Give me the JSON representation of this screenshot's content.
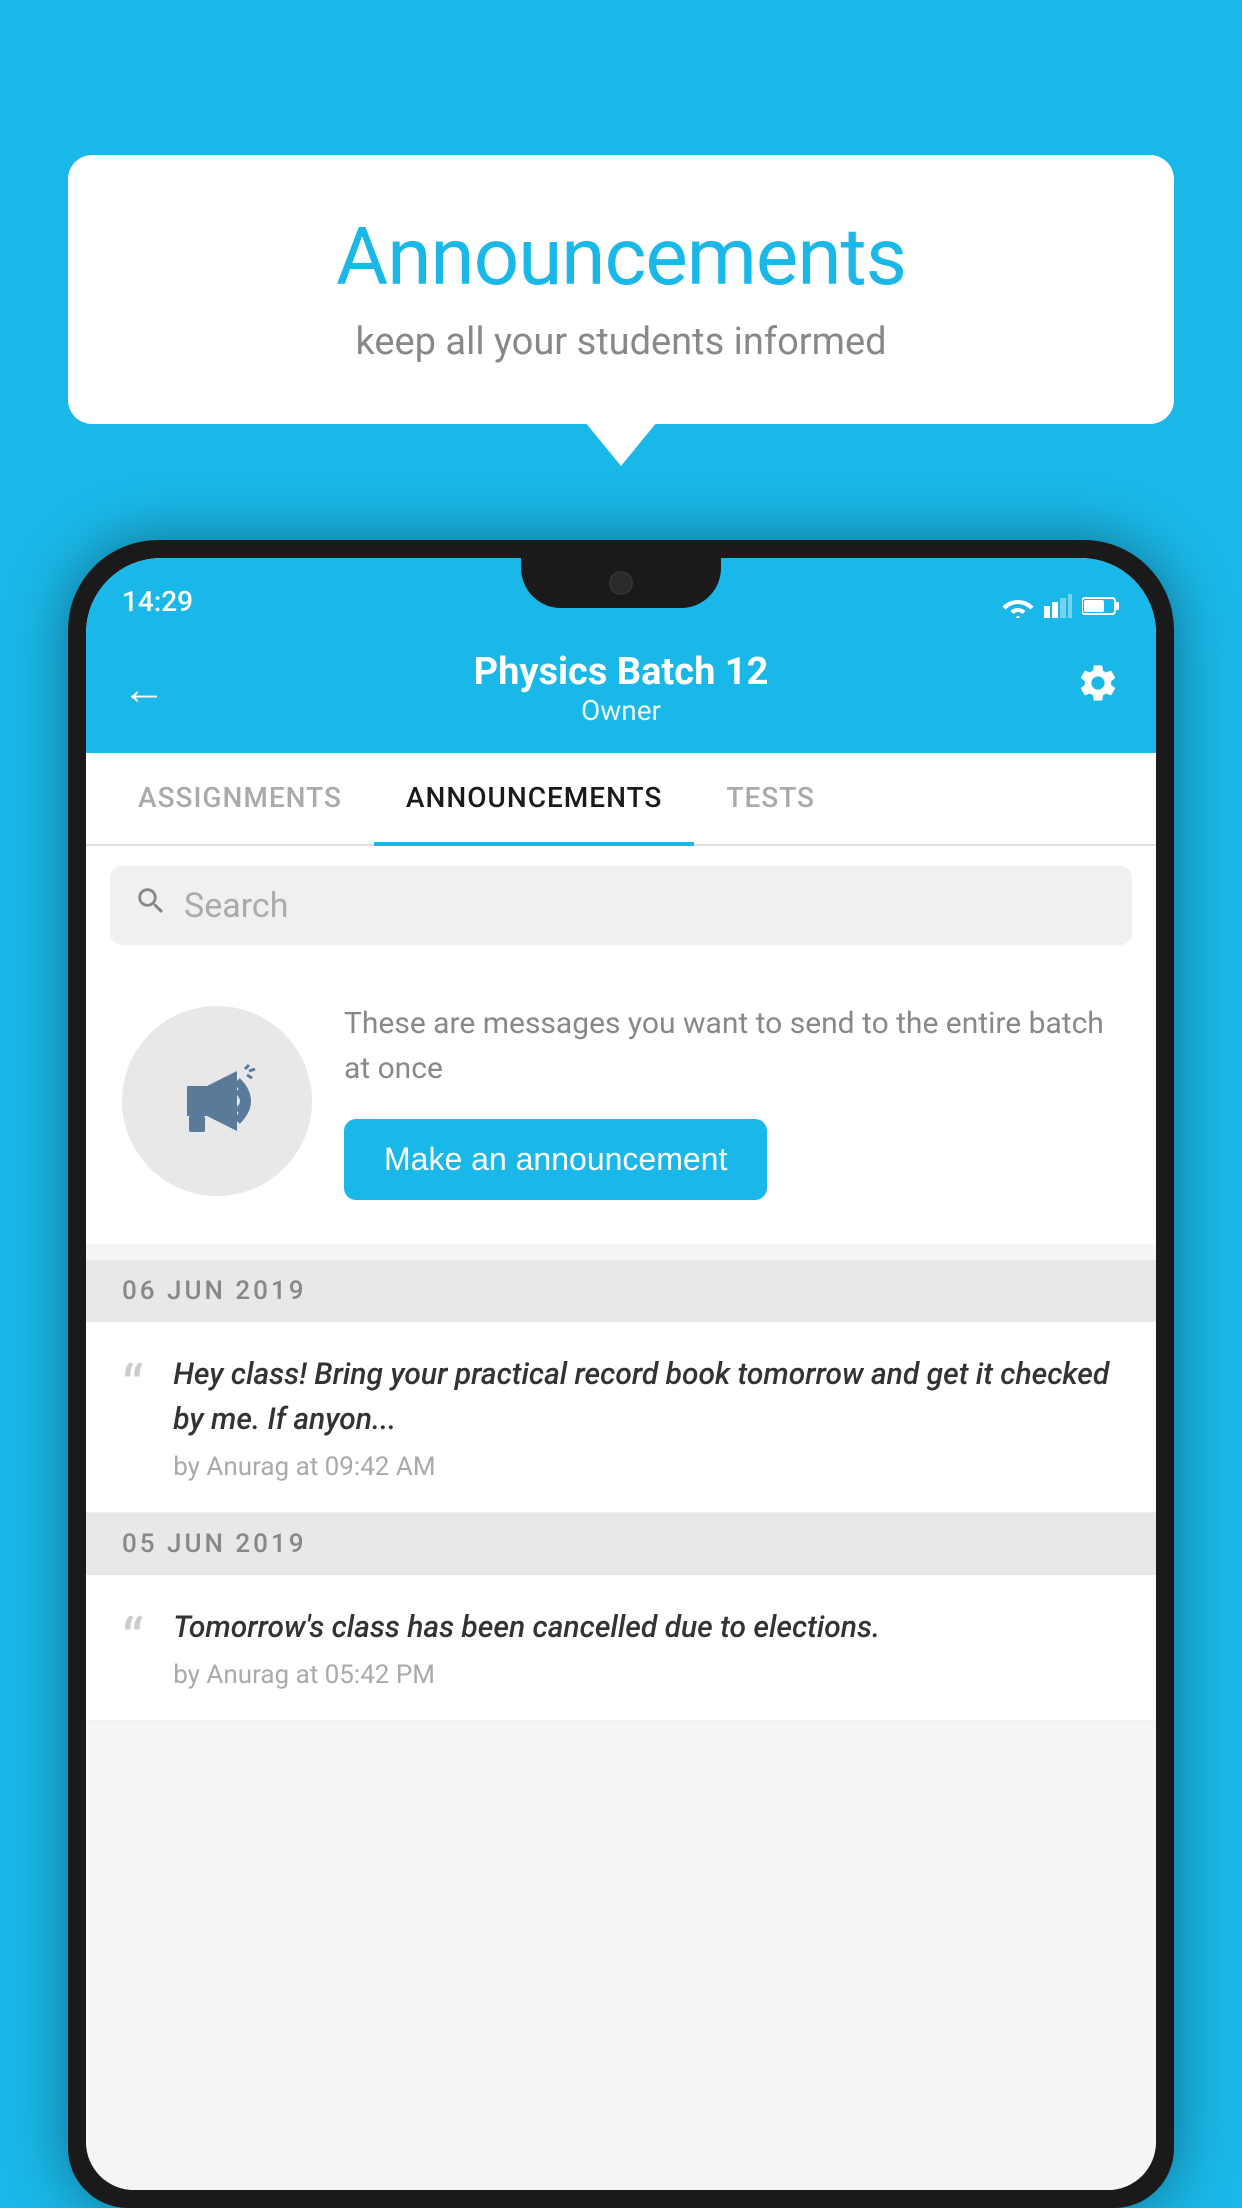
{
  "background_color": "#1ab8e8",
  "speech_bubble": {
    "title": "Announcements",
    "subtitle": "keep all your students informed"
  },
  "phone": {
    "status_bar": {
      "time": "14:29"
    },
    "header": {
      "title": "Physics Batch 12",
      "subtitle": "Owner",
      "back_label": "←",
      "gear_label": "⚙"
    },
    "tabs": [
      {
        "label": "ASSIGNMENTS",
        "active": false
      },
      {
        "label": "ANNOUNCEMENTS",
        "active": true
      },
      {
        "label": "TESTS",
        "active": false
      }
    ],
    "search": {
      "placeholder": "Search"
    },
    "promo": {
      "description": "These are messages you want to send to the entire batch at once",
      "button_label": "Make an announcement"
    },
    "announcements": [
      {
        "date": "06  JUN  2019",
        "text": "Hey class! Bring your practical record book tomorrow and get it checked by me. If anyon...",
        "meta": "by Anurag at 09:42 AM"
      },
      {
        "date": "05  JUN  2019",
        "text": "Tomorrow's class has been cancelled due to elections.",
        "meta": "by Anurag at 05:42 PM"
      }
    ]
  }
}
